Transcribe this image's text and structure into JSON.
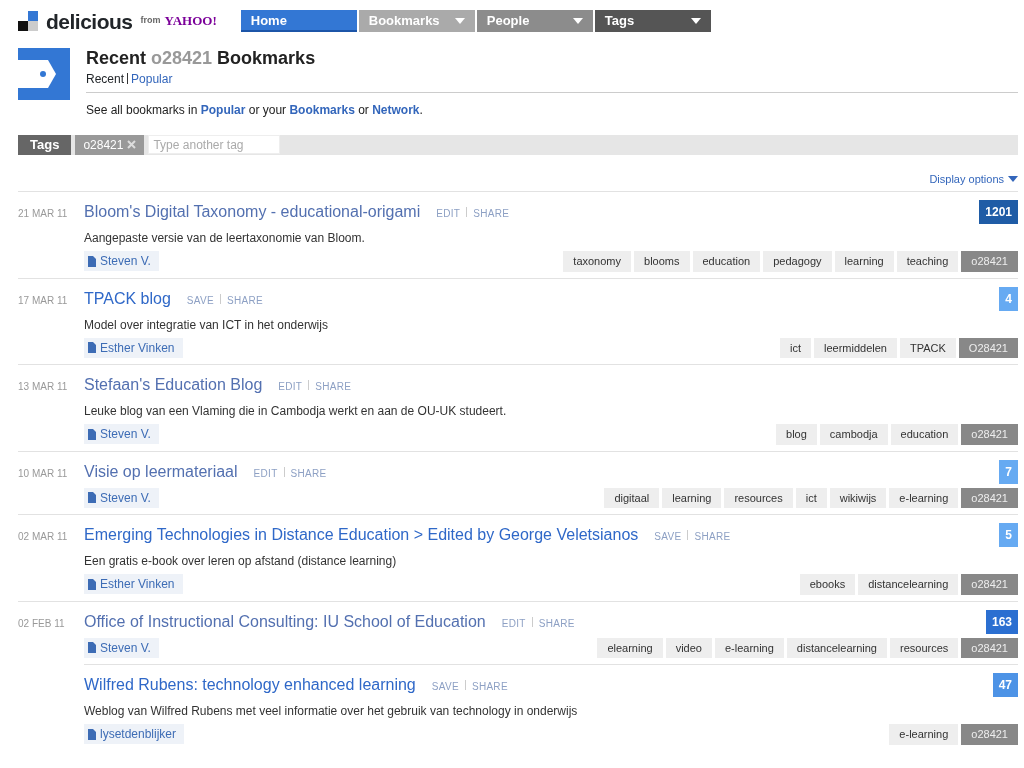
{
  "header": {
    "logo_text": "delicious",
    "from_text": "from",
    "yahoo_text": "YAHOO!",
    "nav": [
      {
        "label": "Home",
        "selected": true,
        "dropdown": false,
        "color": "#3377d4"
      },
      {
        "label": "Bookmarks",
        "selected": false,
        "dropdown": true,
        "color": "#aaaaaa"
      },
      {
        "label": "People",
        "selected": false,
        "dropdown": true,
        "color": "#8c8c8c"
      },
      {
        "label": "Tags",
        "selected": false,
        "dropdown": true,
        "color": "#555555"
      }
    ]
  },
  "title": {
    "prefix": "Recent",
    "tag": "o28421",
    "suffix": "Bookmarks"
  },
  "subnav": [
    {
      "label": "Recent",
      "selected": true
    },
    {
      "label": "Popular",
      "selected": false
    }
  ],
  "see_all": {
    "parts": [
      {
        "kind": "text",
        "text": "See all bookmarks in"
      },
      {
        "kind": "link",
        "text": "Popular"
      },
      {
        "kind": "text",
        "text": "or your"
      },
      {
        "kind": "link",
        "text": "Bookmarks"
      },
      {
        "kind": "text",
        "text": "or"
      },
      {
        "kind": "link",
        "text": "Network"
      },
      {
        "kind": "text",
        "text": "."
      }
    ]
  },
  "tag_bar": {
    "label": "Tags",
    "tags": [
      "o28421"
    ],
    "placeholder": "Type another tag"
  },
  "display_options": "Display options",
  "bookmarks": [
    {
      "date": "21 MAR 11",
      "title": "Bloom's Digital Taxonomy - educational-origami",
      "visited": true,
      "action": "EDIT",
      "share": "SHARE",
      "description": "Aangepaste versie van de leertaxonomie van Bloom.",
      "user": "Steven V.",
      "count": "1201",
      "color": "#1f5ca6",
      "tags": [
        {
          "text": "taxonomy",
          "current": false
        },
        {
          "text": "blooms",
          "current": false
        },
        {
          "text": "education",
          "current": false
        },
        {
          "text": "pedagogy",
          "current": false
        },
        {
          "text": "learning",
          "current": false
        },
        {
          "text": "teaching",
          "current": false
        },
        {
          "text": "o28421",
          "current": true
        }
      ]
    },
    {
      "date": "17 MAR 11",
      "title": "TPACK blog",
      "visited": false,
      "action": "SAVE",
      "share": "SHARE",
      "description": "Model over integratie van ICT in het onderwijs",
      "user": "Esther Vinken",
      "count": "4",
      "color": "#66aaf2",
      "tags": [
        {
          "text": "ict",
          "current": false
        },
        {
          "text": "leermiddelen",
          "current": false
        },
        {
          "text": "TPACK",
          "current": false
        },
        {
          "text": "O28421",
          "current": true
        }
      ]
    },
    {
      "date": "13 MAR 11",
      "title": "Stefaan's Education Blog",
      "visited": true,
      "action": "EDIT",
      "share": "SHARE",
      "description": "Leuke blog van een Vlaming die in Cambodja werkt en aan de OU-UK studeert.",
      "user": "Steven V.",
      "tags": [
        {
          "text": "blog",
          "current": false
        },
        {
          "text": "cambodja",
          "current": false
        },
        {
          "text": "education",
          "current": false
        },
        {
          "text": "o28421",
          "current": true
        }
      ]
    },
    {
      "date": "10 MAR 11",
      "title": "Visie op leermateriaal",
      "visited": true,
      "action": "EDIT",
      "share": "SHARE",
      "user": "Steven V.",
      "count": "7",
      "color": "#66aaf2",
      "tags": [
        {
          "text": "digitaal",
          "current": false
        },
        {
          "text": "learning",
          "current": false
        },
        {
          "text": "resources",
          "current": false
        },
        {
          "text": "ict",
          "current": false
        },
        {
          "text": "wikiwijs",
          "current": false
        },
        {
          "text": "e-learning",
          "current": false
        },
        {
          "text": "o28421",
          "current": true
        }
      ]
    },
    {
      "date": "02 MAR 11",
      "title": "Emerging Technologies in Distance Education > Edited by George Veletsianos",
      "visited": false,
      "action": "SAVE",
      "share": "SHARE",
      "description": "Een gratis e-book over leren op afstand (distance learning)",
      "user": "Esther Vinken",
      "count": "5",
      "color": "#66aaf2",
      "tags": [
        {
          "text": "ebooks",
          "current": false
        },
        {
          "text": "distancelearning",
          "current": false
        },
        {
          "text": "o28421",
          "current": true
        }
      ]
    },
    {
      "date": "02 FEB 11",
      "title": "Office of Instructional Consulting: IU School of Education",
      "visited": true,
      "action": "EDIT",
      "share": "SHARE",
      "user": "Steven V.",
      "count": "163",
      "color": "#2b6fd1",
      "tags": [
        {
          "text": "elearning",
          "current": false
        },
        {
          "text": "video",
          "current": false
        },
        {
          "text": "e-learning",
          "current": false
        },
        {
          "text": "distancelearning",
          "current": false
        },
        {
          "text": "resources",
          "current": false
        },
        {
          "text": "o28421",
          "current": true
        }
      ]
    },
    {
      "title": "Wilfred Rubens: technology enhanced learning",
      "visited": false,
      "action": "SAVE",
      "share": "SHARE",
      "description": "Weblog van Wilfred Rubens met veel informatie over het gebruik van technology in onderwijs",
      "user": "lysetdenblijker",
      "count": "47",
      "color": "#4d93e6",
      "tags": [
        {
          "text": "e-learning",
          "current": false
        },
        {
          "text": "o28421",
          "current": true
        }
      ]
    }
  ]
}
